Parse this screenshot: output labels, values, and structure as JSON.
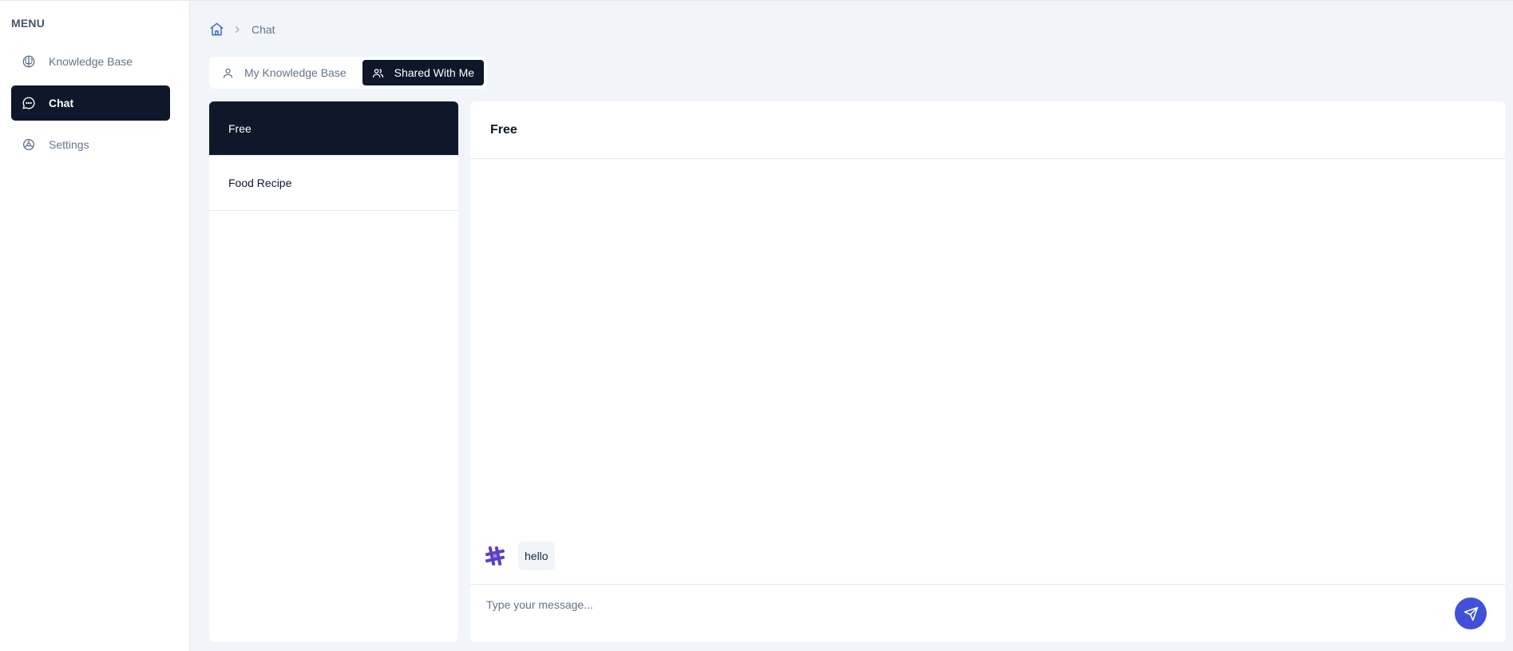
{
  "sidebar": {
    "menu_title": "MENU",
    "items": [
      {
        "label": "Knowledge Base",
        "icon": "brain-icon",
        "active": false
      },
      {
        "label": "Chat",
        "icon": "message-circle-icon",
        "active": true
      },
      {
        "label": "Settings",
        "icon": "settings-icon",
        "active": false
      }
    ]
  },
  "breadcrumb": {
    "home_icon": "home-icon",
    "current": "Chat"
  },
  "tabs": [
    {
      "label": "My Knowledge Base",
      "icon": "user-icon",
      "active": false
    },
    {
      "label": "Shared With Me",
      "icon": "users-icon",
      "active": true
    }
  ],
  "chat_list": {
    "items": [
      {
        "label": "Free",
        "active": true
      },
      {
        "label": "Food Recipe",
        "active": false
      }
    ]
  },
  "chat": {
    "title": "Free",
    "messages": [
      {
        "text": "hello",
        "avatar": "logo-avatar-icon"
      }
    ],
    "input_placeholder": "Type your message...",
    "input_value": "",
    "send_icon": "send-icon"
  },
  "colors": {
    "primary_dark": "#0f172a",
    "accent_blue": "#4051d8",
    "avatar_purple": "#5b3fc4",
    "background": "#f1f5f9",
    "muted_text": "#64748b"
  }
}
